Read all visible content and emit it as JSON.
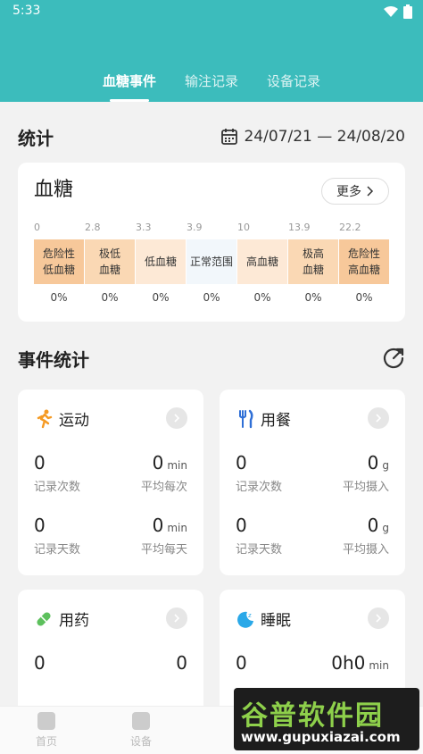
{
  "status_bar": {
    "time": "5:33"
  },
  "tabs": [
    {
      "label": "血糖事件",
      "active": true
    },
    {
      "label": "输注记录",
      "active": false
    },
    {
      "label": "设备记录",
      "active": false
    }
  ],
  "stats": {
    "title": "统计",
    "date_range": "24/07/21 — 24/08/20"
  },
  "glucose": {
    "title": "血糖",
    "more_label": "更多",
    "thresholds": [
      "0",
      "2.8",
      "3.3",
      "3.9",
      "10",
      "13.9",
      "22.2"
    ],
    "levels": [
      {
        "label1": "危险性",
        "label2": "低血糖",
        "pct": "0%",
        "color": "#f7c89a"
      },
      {
        "label1": "极低",
        "label2": "血糖",
        "pct": "0%",
        "color": "#fad8b4"
      },
      {
        "label1": "低血糖",
        "label2": "",
        "pct": "0%",
        "color": "#fde9d6"
      },
      {
        "label1": "正常范围",
        "label2": "",
        "pct": "0%",
        "color": "#f2f7fb"
      },
      {
        "label1": "高血糖",
        "label2": "",
        "pct": "0%",
        "color": "#fde9d6"
      },
      {
        "label1": "极高",
        "label2": "血糖",
        "pct": "0%",
        "color": "#fad8b4"
      },
      {
        "label1": "危险性",
        "label2": "高血糖",
        "pct": "0%",
        "color": "#f7c89a"
      }
    ]
  },
  "events": {
    "title": "事件统计",
    "cards": [
      {
        "title": "运动",
        "icon": "running-icon",
        "rows": [
          {
            "left_val": "0",
            "left_label": "记录次数",
            "right_val": "0",
            "right_unit": "min",
            "right_label": "平均每次"
          },
          {
            "left_val": "0",
            "left_label": "记录天数",
            "right_val": "0",
            "right_unit": "min",
            "right_label": "平均每天"
          }
        ]
      },
      {
        "title": "用餐",
        "icon": "cutlery-icon",
        "rows": [
          {
            "left_val": "0",
            "left_label": "记录次数",
            "right_val": "0",
            "right_unit": "g",
            "right_label": "平均摄入"
          },
          {
            "left_val": "0",
            "left_label": "记录天数",
            "right_val": "0",
            "right_unit": "g",
            "right_label": "平均摄入"
          }
        ]
      },
      {
        "title": "用药",
        "icon": "pill-icon",
        "rows": [
          {
            "left_val": "0",
            "left_label": "",
            "right_val": "0",
            "right_unit": "",
            "right_label": ""
          }
        ]
      },
      {
        "title": "睡眠",
        "icon": "moon-icon",
        "rows": [
          {
            "left_val": "0",
            "left_label": "",
            "right_val": "0h0",
            "right_unit": "min",
            "right_label": ""
          }
        ]
      }
    ]
  },
  "bottom_nav": [
    {
      "label": "首页"
    },
    {
      "label": "设备"
    }
  ],
  "watermark": {
    "brand": "谷普软件园",
    "url": "www.gupuxiazai.com"
  },
  "colors": {
    "accent": "#3cbcbc",
    "exercise": "#f59a23",
    "meal": "#2f6fd6",
    "medicine": "#5cc05c",
    "sleep": "#2aa8e8"
  }
}
